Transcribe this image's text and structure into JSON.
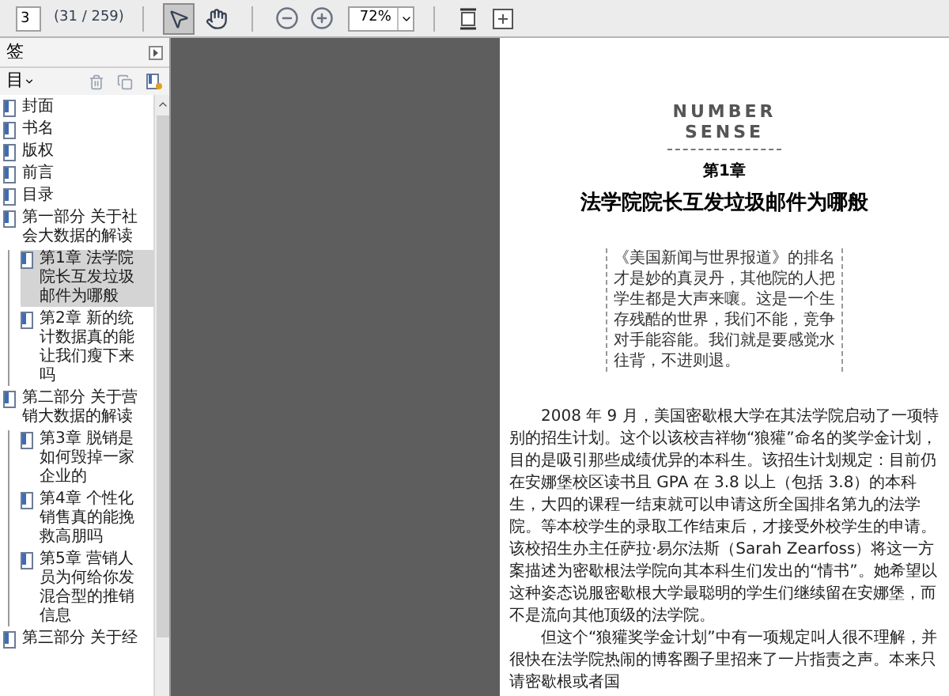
{
  "toolbar": {
    "page_input": "3",
    "page_count": "(31 / 259)",
    "tools": [
      {
        "kind": "select",
        "selected": true
      },
      {
        "kind": "hand",
        "selected": false
      }
    ],
    "zoom": "72%"
  },
  "sidebar": {
    "title": "签",
    "options_label": "目",
    "items": [
      {
        "label": "封面",
        "selected": false
      },
      {
        "label": "书名",
        "selected": false
      },
      {
        "label": "版权",
        "selected": false
      },
      {
        "label": "前言",
        "selected": false
      },
      {
        "label": "目录",
        "selected": false
      },
      {
        "label": "第一部分 关于社会大数据的解读",
        "selected": false,
        "children": [
          {
            "label": "第1章 法学院院长互发垃圾邮件为哪般",
            "selected": true
          },
          {
            "label": "第2章 新的统计数据真的能让我们瘦下来吗",
            "selected": false
          }
        ]
      },
      {
        "label": "第二部分 关于营销大数据的解读",
        "selected": false,
        "children": [
          {
            "label": "第3章 脱销是如何毁掉一家企业的",
            "selected": false
          },
          {
            "label": "第4章 个性化销售真的能挽救高朋吗",
            "selected": false
          },
          {
            "label": "第5章 营销人员为何给你发混合型的推销信息",
            "selected": false
          }
        ]
      },
      {
        "label": "第三部分 关于经",
        "selected": false
      }
    ]
  },
  "page": {
    "logo": [
      "NUMBER",
      "SENSE"
    ],
    "chapter": "第1章",
    "title": "法学院院长互发垃圾邮件为哪般",
    "quote": "《美国新闻与世界报道》的排名才是妙的真灵丹，其他院的人把学生都是大声来嚷。这是一个生存残酷的世界，我们不能，竞争对手能容能。我们就是要感觉水往背，不进则退。",
    "paragraphs": [
      "2008 年 9 月，美国密歇根大学在其法学院启动了一项特别的招生计划。这个以该校吉祥物“狼獾”命名的奖学金计划，目的是吸引那些成绩优异的本科生。该招生计划规定：目前仍在安娜堡校区读书且 GPA 在 3.8 以上（包括 3.8）的本科生，大四的课程一结束就可以申请这所全国排名第九的法学院。等本校学生的录取工作结束后，才接受外校学生的申请。该校招生办主任萨拉·易尔法斯（Sarah Zearfoss）将这一方案描述为密歇根法学院向其本科生们发出的“情书”。她希望以这种姿态说服密歇根大学最聪明的学生们继续留在安娜堡，而不是流向其他顶级的法学院。",
      "但这个“狼獾奖学金计划”中有一项规定叫人很不理解，并很快在法学院热闹的博客圈子里招来了一片指责之声。本来只请密歇根或者国"
    ]
  }
}
